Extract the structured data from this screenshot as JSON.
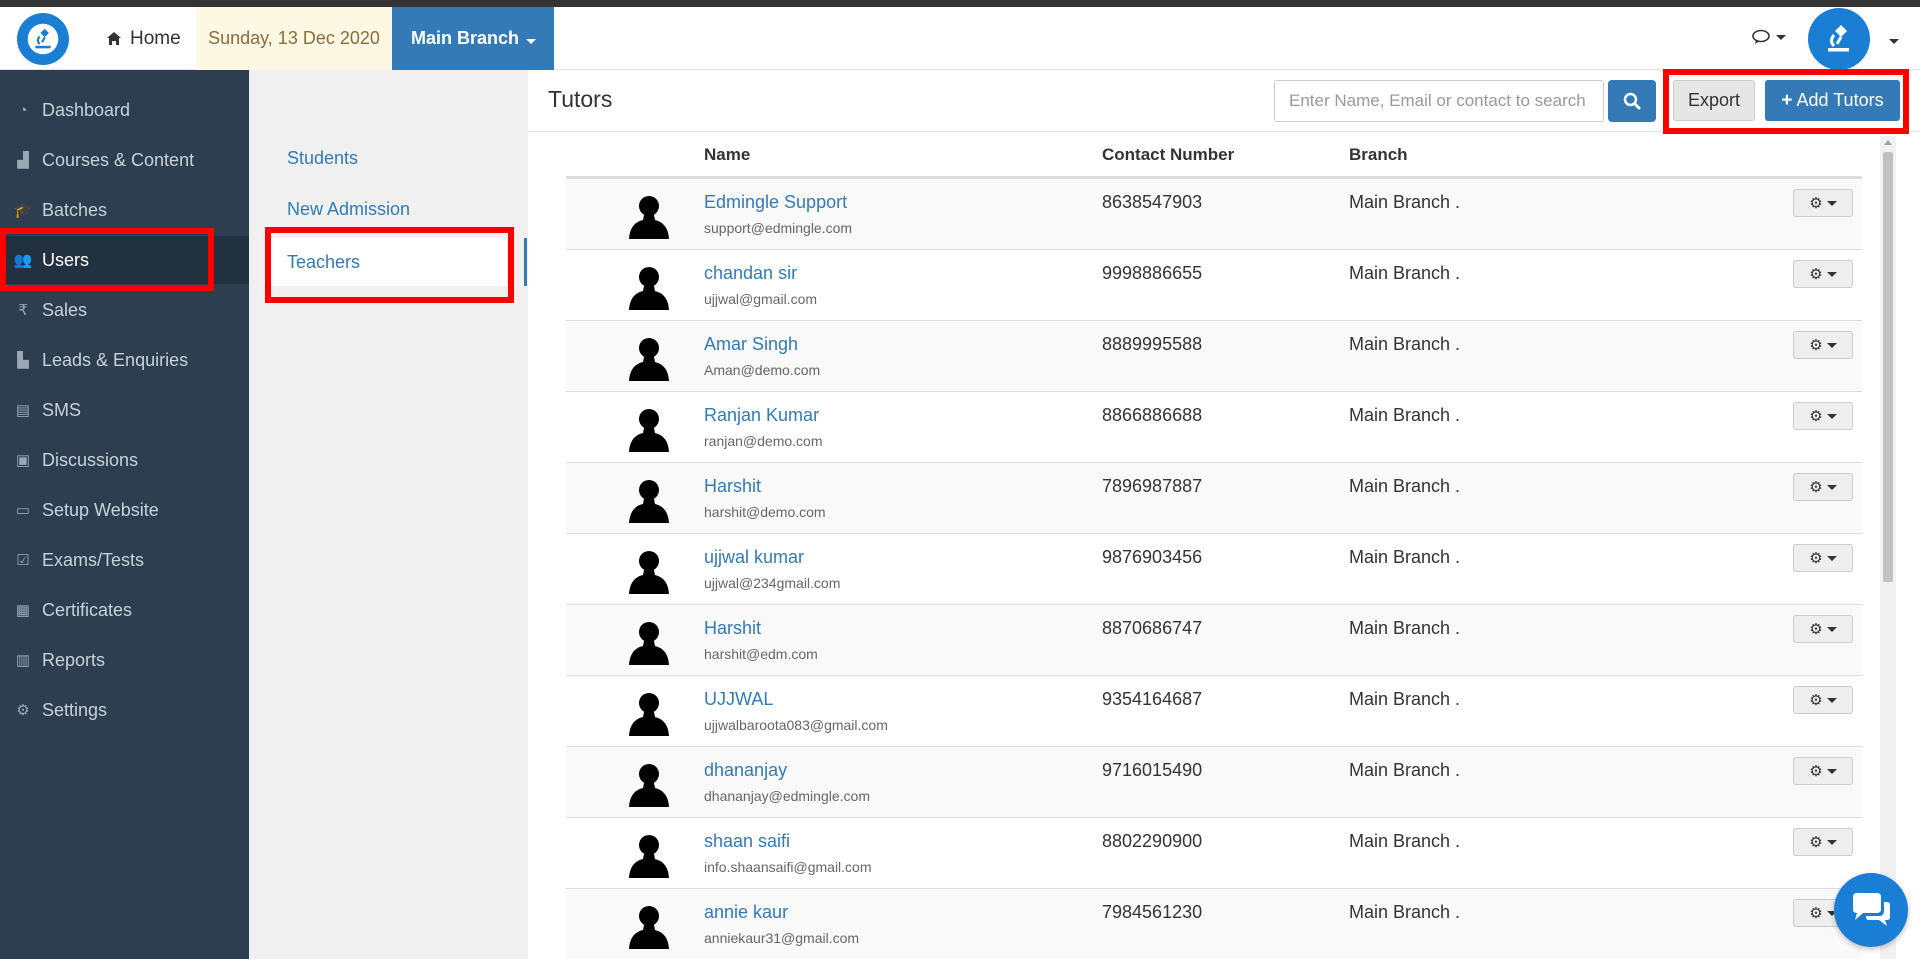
{
  "navbar": {
    "home_label": "Home",
    "date": "Sunday, 13 Dec 2020",
    "branch": "Main Branch"
  },
  "sidebar": {
    "items": [
      {
        "label": "Dashboard",
        "icon": "dashboard-icon"
      },
      {
        "label": "Courses & Content",
        "icon": "courses-icon"
      },
      {
        "label": "Batches",
        "icon": "graduation-cap-icon"
      },
      {
        "label": "Users",
        "icon": "users-icon"
      },
      {
        "label": "Sales",
        "icon": "rupee-icon"
      },
      {
        "label": "Leads & Enquiries",
        "icon": "leads-icon"
      },
      {
        "label": "SMS",
        "icon": "sms-icon"
      },
      {
        "label": "Discussions",
        "icon": "discussions-icon"
      },
      {
        "label": "Setup Website",
        "icon": "laptop-icon"
      },
      {
        "label": "Exams/Tests",
        "icon": "checkbox-icon"
      },
      {
        "label": "Certificates",
        "icon": "certificate-icon"
      },
      {
        "label": "Reports",
        "icon": "bar-chart-icon"
      },
      {
        "label": "Settings",
        "icon": "gear-icon"
      }
    ],
    "active": "Users"
  },
  "subnav": {
    "items": [
      "Students",
      "New Admission",
      "Teachers"
    ],
    "active": "Teachers"
  },
  "main": {
    "title": "Tutors",
    "search_placeholder": "Enter Name, Email or contact to search",
    "export_label": "Export",
    "add_label": "Add Tutors",
    "columns": [
      "Name",
      "Contact Number",
      "Branch"
    ],
    "rows": [
      {
        "name": "Edmingle Support",
        "email": "support@edmingle.com",
        "phone": "8638547903",
        "branch": "Main Branch ."
      },
      {
        "name": "chandan sir",
        "email": "ujjwal@gmail.com",
        "phone": "9998886655",
        "branch": "Main Branch ."
      },
      {
        "name": "Amar Singh",
        "email": "Aman@demo.com",
        "phone": "8889995588",
        "branch": "Main Branch ."
      },
      {
        "name": "Ranjan Kumar",
        "email": "ranjan@demo.com",
        "phone": "8866886688",
        "branch": "Main Branch ."
      },
      {
        "name": "Harshit",
        "email": "harshit@demo.com",
        "phone": "7896987887",
        "branch": "Main Branch ."
      },
      {
        "name": "ujjwal kumar",
        "email": "ujjwal@234gmail.com",
        "phone": "9876903456",
        "branch": "Main Branch ."
      },
      {
        "name": "Harshit",
        "email": "harshit@edm.com",
        "phone": "8870686747",
        "branch": "Main Branch ."
      },
      {
        "name": "UJJWAL",
        "email": "ujjwalbaroota083@gmail.com",
        "phone": "9354164687",
        "branch": "Main Branch ."
      },
      {
        "name": "dhananjay",
        "email": "dhananjay@edmingle.com",
        "phone": "9716015490",
        "branch": "Main Branch ."
      },
      {
        "name": "shaan saifi",
        "email": "info.shaansaifi@gmail.com",
        "phone": "8802290900",
        "branch": "Main Branch ."
      },
      {
        "name": "annie kaur",
        "email": "anniekaur31@gmail.com",
        "phone": "7984561230",
        "branch": "Main Branch ."
      }
    ]
  },
  "colors": {
    "accent": "#337ab7",
    "sidebar_bg": "#2c3e50",
    "highlight": "#ff0000",
    "date_bg": "#fcf8e3"
  }
}
